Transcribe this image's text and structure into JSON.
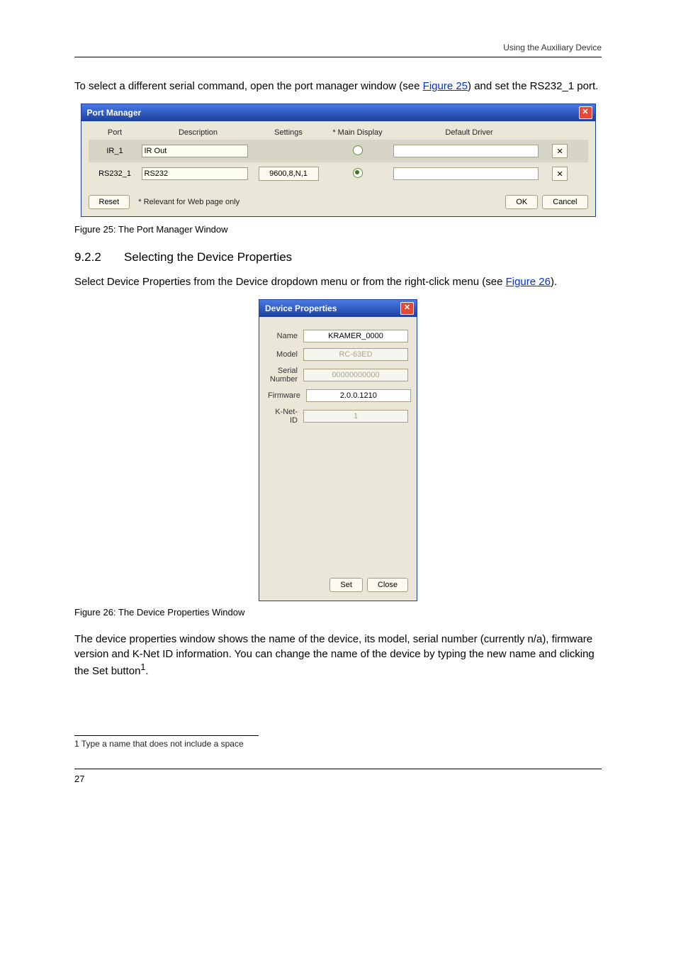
{
  "page_header": "Using the Auxiliary Device",
  "intro_text": "To select a different serial command, open the port manager window (see ",
  "intro_link": "Figure 25",
  "intro_text2": ") and set the RS232_1 port.",
  "port_manager": {
    "title": "Port Manager",
    "headers": {
      "port": "Port",
      "description": "Description",
      "settings": "Settings",
      "main_display": "* Main Display",
      "default_driver": "Default Driver"
    },
    "rows": [
      {
        "port": "IR_1",
        "description": "IR Out",
        "settings": "",
        "main_display_selected": false
      },
      {
        "port": "RS232_1",
        "description": "RS232",
        "settings": "9600,8,N,1",
        "main_display_selected": true
      }
    ],
    "footer": {
      "reset": "Reset",
      "note": "*   Relevant for Web page only",
      "ok": "OK",
      "cancel": "Cancel"
    }
  },
  "fig25_caption": "Figure 25: The Port Manager Window",
  "section_device_properties": {
    "num": "9.2.2",
    "title": "Selecting the Device Properties"
  },
  "dp_intro": "Select Device Properties from the Device dropdown menu or from the right-click menu (see ",
  "dp_link": "Figure 26",
  "dp_intro2": ").",
  "device_properties": {
    "title": "Device Properties",
    "rows": {
      "name_label": "Name",
      "name_value": "KRAMER_0000",
      "model_label": "Model",
      "model_value": "RC-63ED",
      "serial_label": "Serial Number",
      "serial_value": "00000000000",
      "firmware_label": "Firmware",
      "firmware_value": "2.0.0.1210",
      "knet_label": "K-Net-ID",
      "knet_value": "1"
    },
    "footer": {
      "set": "Set",
      "close": "Close"
    }
  },
  "fig26_caption": "Figure 26: The Device Properties Window",
  "dp_desc": "The device properties window shows the name of the device, its model, serial number (currently n/a), firmware version and K-Net ID information. You can change the name of the device by typing the new name and clicking the Set button",
  "dp_desc_super": "1",
  "dp_desc_tail": ".",
  "footnote": "1 Type a name that does not include a space",
  "page_number": "27"
}
